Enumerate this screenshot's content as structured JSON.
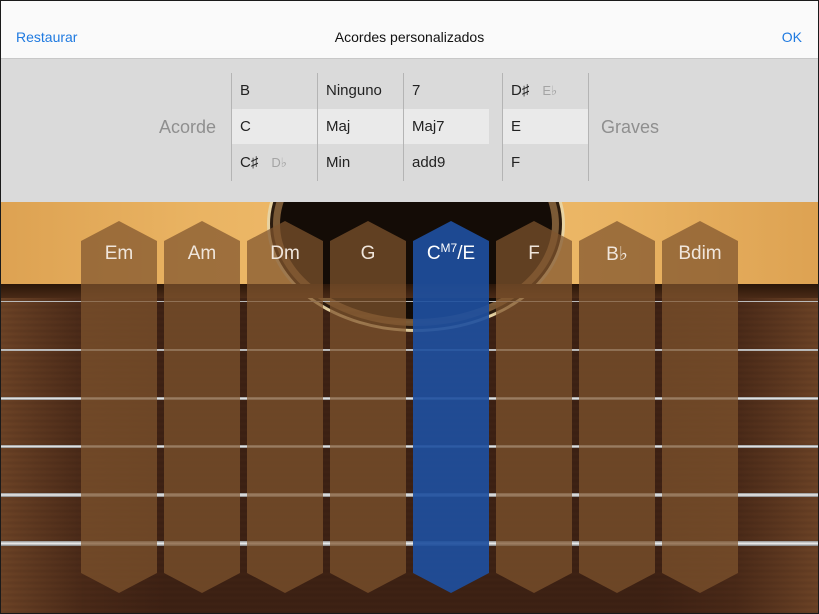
{
  "navbar": {
    "left_button": "Restaurar",
    "title": "Acordes personalizados",
    "right_button": "OK"
  },
  "picker": {
    "left_label": "Acorde",
    "right_label": "Graves",
    "columns": [
      {
        "rows": [
          {
            "text": "B",
            "alt": ""
          },
          {
            "text": "C",
            "alt": ""
          },
          {
            "text": "C♯",
            "alt": "D♭"
          }
        ],
        "selected": 1
      },
      {
        "rows": [
          {
            "text": "Ninguno",
            "alt": ""
          },
          {
            "text": "Maj",
            "alt": ""
          },
          {
            "text": "Min",
            "alt": ""
          }
        ],
        "selected": 1
      },
      {
        "rows": [
          {
            "text": "7",
            "alt": ""
          },
          {
            "text": "Maj7",
            "alt": ""
          },
          {
            "text": "add9",
            "alt": ""
          }
        ],
        "selected": 1
      },
      {
        "rows": [
          {
            "text": "D♯",
            "alt": "E♭"
          },
          {
            "text": "E",
            "alt": ""
          },
          {
            "text": "F",
            "alt": ""
          }
        ],
        "selected": 1
      }
    ]
  },
  "chords": [
    {
      "label": "Em"
    },
    {
      "label": "Am"
    },
    {
      "label": "Dm"
    },
    {
      "label": "G"
    },
    {
      "label": "C",
      "sup": "M7",
      "suffix": "/E",
      "active": true
    },
    {
      "label": "F"
    },
    {
      "label": "B♭"
    },
    {
      "label": "Bdim"
    }
  ],
  "colors": {
    "accent": "#1f7ae0",
    "strip": "#80552e",
    "strip_active": "#1e4f9e"
  }
}
